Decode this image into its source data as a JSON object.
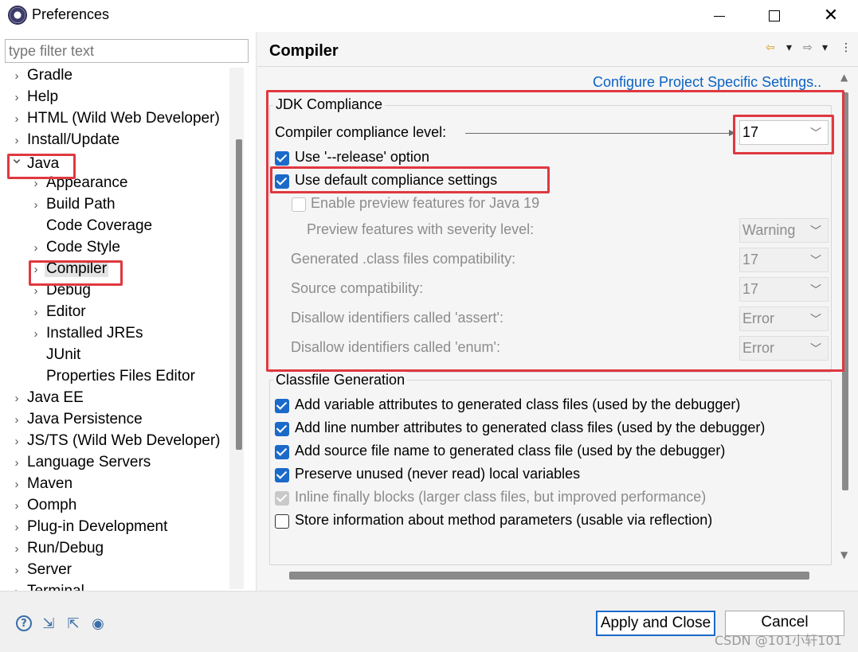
{
  "window": {
    "title": "Preferences",
    "minimize_label": "—",
    "maximize_label": "☐",
    "close_label": "✕"
  },
  "filter": {
    "placeholder": "type filter text"
  },
  "tree": {
    "items": [
      {
        "label": "Gradle",
        "level": 0,
        "expandable": true,
        "expanded": false
      },
      {
        "label": "Help",
        "level": 0,
        "expandable": true,
        "expanded": false
      },
      {
        "label": "HTML (Wild Web Developer)",
        "level": 0,
        "expandable": true,
        "expanded": false
      },
      {
        "label": "Install/Update",
        "level": 0,
        "expandable": true,
        "expanded": false
      },
      {
        "label": "Java",
        "level": 0,
        "expandable": true,
        "expanded": true
      },
      {
        "label": "Appearance",
        "level": 1,
        "expandable": true,
        "expanded": false
      },
      {
        "label": "Build Path",
        "level": 1,
        "expandable": true,
        "expanded": false
      },
      {
        "label": "Code Coverage",
        "level": 1,
        "expandable": false,
        "expanded": false
      },
      {
        "label": "Code Style",
        "level": 1,
        "expandable": true,
        "expanded": false
      },
      {
        "label": "Compiler",
        "level": 1,
        "expandable": true,
        "expanded": false,
        "selected": true
      },
      {
        "label": "Debug",
        "level": 1,
        "expandable": true,
        "expanded": false
      },
      {
        "label": "Editor",
        "level": 1,
        "expandable": true,
        "expanded": false
      },
      {
        "label": "Installed JREs",
        "level": 1,
        "expandable": true,
        "expanded": false
      },
      {
        "label": "JUnit",
        "level": 1,
        "expandable": false,
        "expanded": false
      },
      {
        "label": "Properties Files Editor",
        "level": 1,
        "expandable": false,
        "expanded": false
      },
      {
        "label": "Java EE",
        "level": 0,
        "expandable": true,
        "expanded": false
      },
      {
        "label": "Java Persistence",
        "level": 0,
        "expandable": true,
        "expanded": false
      },
      {
        "label": "JS/TS (Wild Web Developer)",
        "level": 0,
        "expandable": true,
        "expanded": false
      },
      {
        "label": "Language Servers",
        "level": 0,
        "expandable": true,
        "expanded": false
      },
      {
        "label": "Maven",
        "level": 0,
        "expandable": true,
        "expanded": false
      },
      {
        "label": "Oomph",
        "level": 0,
        "expandable": true,
        "expanded": false
      },
      {
        "label": "Plug-in Development",
        "level": 0,
        "expandable": true,
        "expanded": false
      },
      {
        "label": "Run/Debug",
        "level": 0,
        "expandable": true,
        "expanded": false
      },
      {
        "label": "Server",
        "level": 0,
        "expandable": true,
        "expanded": false
      },
      {
        "label": "Terminal",
        "level": 0,
        "expandable": true,
        "expanded": false
      }
    ]
  },
  "page": {
    "title": "Compiler",
    "config_link": "Configure Project Specific Settings..",
    "back_icon": "⇦",
    "forward_icon": "⇨",
    "dropdown_icon": "▾",
    "menu_icon": "⋮"
  },
  "jdk": {
    "group_title": "JDK Compliance",
    "compliance_label": "Compiler compliance level:",
    "compliance_value": "17",
    "use_release": {
      "label": "Use '--release' option",
      "checked": true
    },
    "use_default": {
      "label": "Use default compliance settings",
      "checked": true
    },
    "enable_preview": {
      "label": "Enable preview features for Java 19",
      "checked": false,
      "enabled": false
    },
    "preview_severity": {
      "label": "Preview features with severity level:",
      "value": "Warning"
    },
    "generated_class": {
      "label": "Generated .class files compatibility:",
      "value": "17"
    },
    "source_compat": {
      "label": "Source compatibility:",
      "value": "17"
    },
    "assert_ids": {
      "label": "Disallow identifiers called 'assert':",
      "value": "Error"
    },
    "enum_ids": {
      "label": "Disallow identifiers called 'enum':",
      "value": "Error"
    }
  },
  "classfile": {
    "group_title": "Classfile Generation",
    "options": [
      {
        "label": "Add variable attributes to generated class files (used by the debugger)",
        "checked": true,
        "enabled": true
      },
      {
        "label": "Add line number attributes to generated class files (used by the debugger)",
        "checked": true,
        "enabled": true
      },
      {
        "label": "Add source file name to generated class file (used by the debugger)",
        "checked": true,
        "enabled": true
      },
      {
        "label": "Preserve unused (never read) local variables",
        "checked": true,
        "enabled": true
      },
      {
        "label": "Inline finally blocks (larger class files, but improved performance)",
        "checked": true,
        "enabled": false
      },
      {
        "label": "Store information about method parameters (usable via reflection)",
        "checked": false,
        "enabled": true
      }
    ]
  },
  "footer": {
    "help_icon": "?",
    "import_icon": "⇲",
    "export_icon": "⇱",
    "record_icon": "◉",
    "apply_close_label": "Apply and Close",
    "cancel_label": "Cancel",
    "watermark": "CSDN @101小轩101"
  },
  "colors": {
    "accent": "#1b6ac9",
    "link": "#0b62c4",
    "annotation": "#e03840"
  }
}
